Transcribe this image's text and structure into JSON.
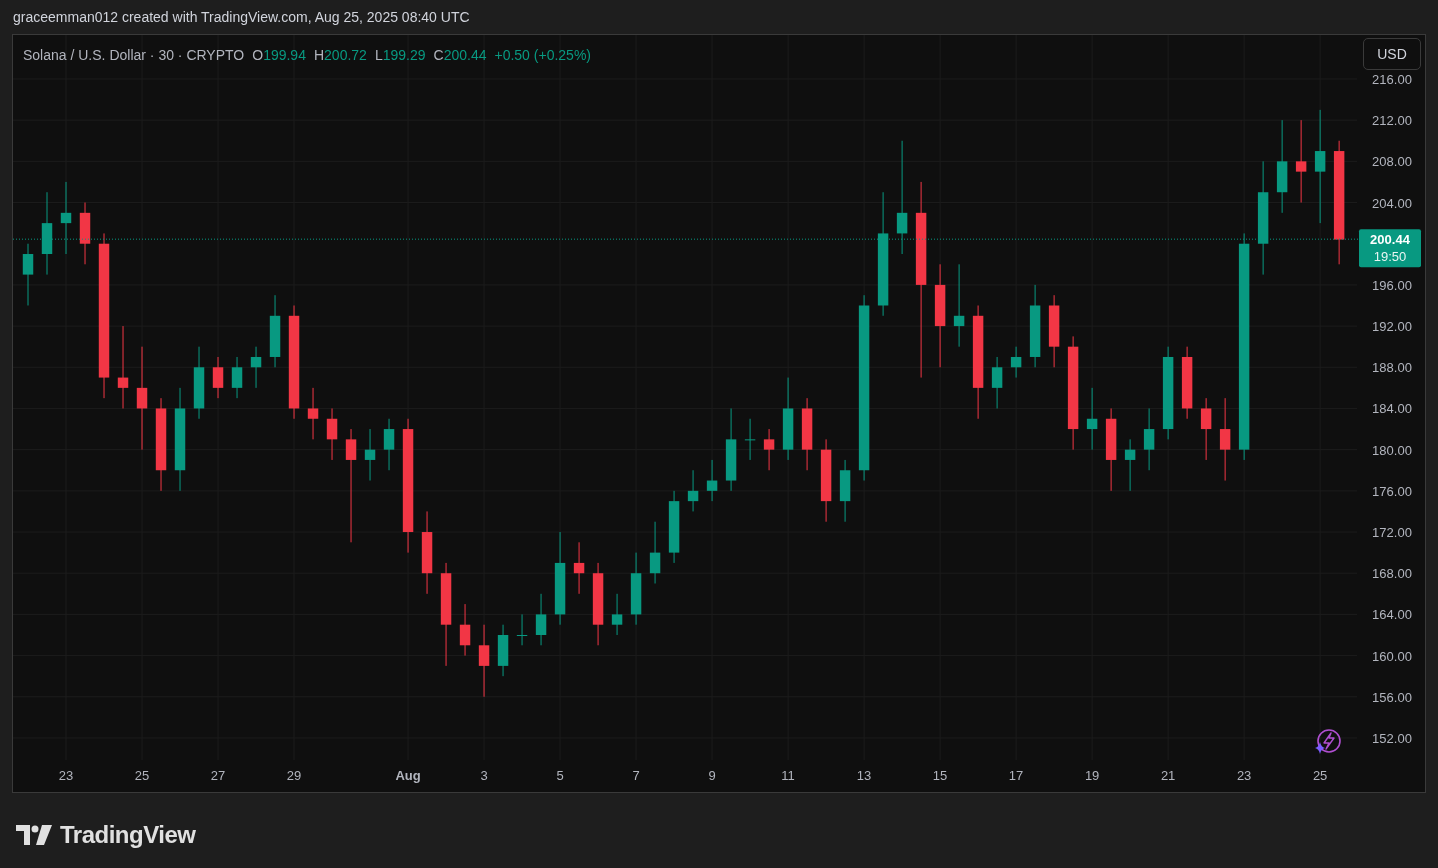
{
  "header": {
    "caption": "graceemman012 created with TradingView.com, Aug 25, 2025 08:40 UTC"
  },
  "legend": {
    "symbol": "Solana / U.S. Dollar · 30 · CRYPTO",
    "ohlc": [
      {
        "label": "O",
        "value": "199.94"
      },
      {
        "label": "H",
        "value": "200.72"
      },
      {
        "label": "L",
        "value": "199.29"
      },
      {
        "label": "C",
        "value": "200.44"
      }
    ],
    "change": "+0.50 (+0.25%)"
  },
  "currency_button": "USD",
  "chart_data": {
    "type": "candlestick",
    "categories": [
      null,
      null,
      "23",
      null,
      null,
      null,
      "25",
      null,
      null,
      null,
      "27",
      null,
      null,
      null,
      "29",
      null,
      null,
      null,
      null,
      null,
      "Aug",
      null,
      null,
      null,
      "3",
      null,
      null,
      null,
      "5",
      null,
      null,
      null,
      "7",
      null,
      null,
      null,
      "9",
      null,
      null,
      null,
      "11",
      null,
      null,
      null,
      "13",
      null,
      null,
      null,
      "15",
      null,
      null,
      null,
      "17",
      null,
      null,
      null,
      "19",
      null,
      null,
      null,
      "21",
      null,
      null,
      null,
      "23",
      null,
      null,
      null,
      "25",
      null
    ],
    "ohlc": [
      [
        197,
        200,
        194,
        199
      ],
      [
        199,
        205,
        197,
        202
      ],
      [
        202,
        206,
        199,
        203
      ],
      [
        203,
        204,
        198,
        200
      ],
      [
        200,
        201,
        185,
        187
      ],
      [
        187,
        192,
        184,
        186
      ],
      [
        186,
        190,
        180,
        184
      ],
      [
        184,
        185,
        176,
        178
      ],
      [
        178,
        186,
        176,
        184
      ],
      [
        184,
        190,
        183,
        188
      ],
      [
        188,
        189,
        185,
        186
      ],
      [
        186,
        189,
        185,
        188
      ],
      [
        188,
        190,
        186,
        189
      ],
      [
        189,
        195,
        188,
        193
      ],
      [
        193,
        194,
        183,
        184
      ],
      [
        184,
        186,
        181,
        183
      ],
      [
        183,
        184,
        179,
        181
      ],
      [
        181,
        182,
        171,
        179
      ],
      [
        179,
        182,
        177,
        180
      ],
      [
        180,
        183,
        178,
        182
      ],
      [
        182,
        183,
        170,
        172
      ],
      [
        172,
        174,
        166,
        168
      ],
      [
        168,
        169,
        159,
        163
      ],
      [
        163,
        165,
        160,
        161
      ],
      [
        161,
        163,
        156,
        159
      ],
      [
        159,
        163,
        158,
        162
      ],
      [
        162,
        164,
        161,
        162
      ],
      [
        162,
        166,
        161,
        164
      ],
      [
        164,
        172,
        163,
        169
      ],
      [
        169,
        171,
        166,
        168
      ],
      [
        168,
        169,
        161,
        163
      ],
      [
        163,
        166,
        162,
        164
      ],
      [
        164,
        170,
        163,
        168
      ],
      [
        168,
        173,
        167,
        170
      ],
      [
        170,
        176,
        169,
        175
      ],
      [
        175,
        178,
        174,
        176
      ],
      [
        176,
        179,
        175,
        177
      ],
      [
        177,
        184,
        176,
        181
      ],
      [
        181,
        183,
        179,
        181
      ],
      [
        181,
        182,
        178,
        180
      ],
      [
        180,
        187,
        179,
        184
      ],
      [
        184,
        185,
        178,
        180
      ],
      [
        180,
        181,
        173,
        175
      ],
      [
        175,
        179,
        173,
        178
      ],
      [
        178,
        195,
        177,
        194
      ],
      [
        194,
        205,
        193,
        201
      ],
      [
        201,
        210,
        199,
        203
      ],
      [
        203,
        206,
        187,
        196
      ],
      [
        196,
        198,
        188,
        192
      ],
      [
        192,
        198,
        190,
        193
      ],
      [
        193,
        194,
        183,
        186
      ],
      [
        186,
        189,
        184,
        188
      ],
      [
        188,
        190,
        187,
        189
      ],
      [
        189,
        196,
        188,
        194
      ],
      [
        194,
        195,
        188,
        190
      ],
      [
        190,
        191,
        180,
        182
      ],
      [
        182,
        186,
        180,
        183
      ],
      [
        183,
        184,
        176,
        179
      ],
      [
        179,
        181,
        176,
        180
      ],
      [
        180,
        184,
        178,
        182
      ],
      [
        182,
        190,
        181,
        189
      ],
      [
        189,
        190,
        183,
        184
      ],
      [
        184,
        185,
        179,
        182
      ],
      [
        182,
        185,
        177,
        180
      ],
      [
        180,
        201,
        179,
        200
      ],
      [
        200,
        208,
        197,
        205
      ],
      [
        205,
        212,
        203,
        208
      ],
      [
        208,
        212,
        204,
        207
      ],
      [
        207,
        213,
        202,
        209
      ],
      [
        209,
        210,
        198,
        200.4
      ]
    ],
    "grid": true,
    "ylim": [
      149.86,
      220.27
    ],
    "yticks": [
      {
        "value": 152,
        "label": "152.00"
      },
      {
        "value": 156,
        "label": "156.00"
      },
      {
        "value": 160,
        "label": "160.00"
      },
      {
        "value": 164,
        "label": "164.00"
      },
      {
        "value": 168,
        "label": "168.00"
      },
      {
        "value": 172,
        "label": "172.00"
      },
      {
        "value": 176,
        "label": "176.00"
      },
      {
        "value": 180,
        "label": "180.00"
      },
      {
        "value": 184,
        "label": "184.00"
      },
      {
        "value": 188,
        "label": "188.00"
      },
      {
        "value": 192,
        "label": "192.00"
      },
      {
        "value": 196,
        "label": "196.00"
      },
      {
        "value": 204,
        "label": "204.00"
      },
      {
        "value": 208,
        "label": "208.00"
      },
      {
        "value": 212,
        "label": "212.00"
      },
      {
        "value": 216,
        "label": "216.00"
      }
    ],
    "ref_lines": [
      {
        "axis": "y",
        "value": 200.44,
        "label": "200.44"
      }
    ]
  },
  "countdown": "19:50",
  "footer": {
    "brand": "TradingView"
  }
}
